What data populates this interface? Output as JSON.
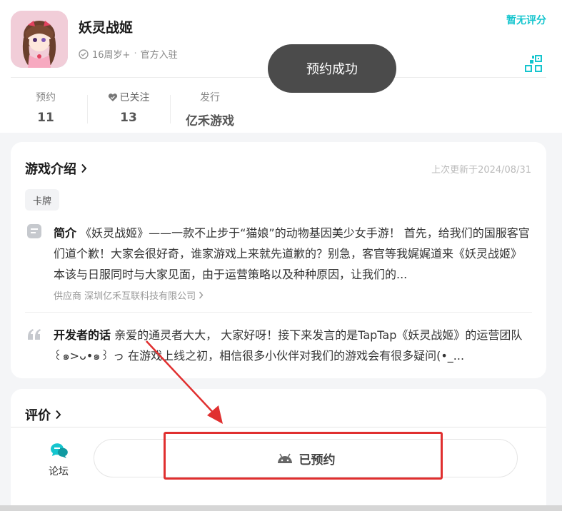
{
  "game": {
    "title": "妖灵战姬",
    "age_rating": "16周岁+",
    "separator": "·",
    "official": "官方入驻",
    "rating_text": "暂无评分"
  },
  "toast": {
    "text": "预约成功"
  },
  "stats": {
    "reservations": {
      "label": "预约",
      "value": "11"
    },
    "followed": {
      "label": "已关注",
      "value": "13"
    },
    "publisher": {
      "label": "发行",
      "value": "亿禾游戏"
    }
  },
  "intro": {
    "title": "游戏介绍",
    "updated": "上次更新于2024/08/31",
    "tag": "卡牌",
    "summary_label": "简介",
    "summary_text": "《妖灵战姬》——一款不止步于“猫娘”的动物基因美少女手游！ 首先，给我们的国服客官们道个歉！大家会很好奇，谁家游戏上来就先道歉的？别急，客官等我娓娓道来《妖灵战姬》本该与日服同时与大家见面，由于运营策略以及种种原因，让我们的...",
    "supplier": "供应商 深圳亿禾互联科技有限公司",
    "dev_label": "开发者的话",
    "dev_text": "亲爱的通灵者大大， 大家好呀！接下来发言的是TapTap《妖灵战姬》的运营团队 ꒰๑>ᴗ•๑꒱ っ 在游戏上线之初，相信很多小伙伴对我们的游戏会有很多疑问(•_..."
  },
  "review": {
    "title": "评价"
  },
  "bottom": {
    "forum_label": "论坛",
    "reserved_label": "已预约"
  },
  "colors": {
    "accent": "#15c5ce",
    "toast_bg": "#4b4b4b",
    "annotation_red": "#e02f2f"
  }
}
